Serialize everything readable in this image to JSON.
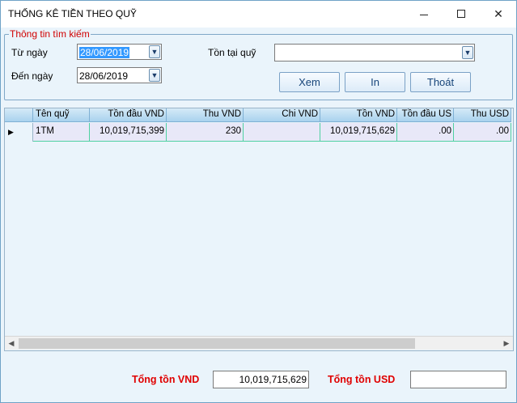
{
  "window": {
    "title": "THỐNG KÊ TIỀN THEO QUỸ"
  },
  "search": {
    "legend": "Thông tin tìm kiếm",
    "from_label": "Từ ngày",
    "from_value": "28/06/2019",
    "to_label": "Đến ngày",
    "to_value": "28/06/2019",
    "fund_label": "Tồn tại quỹ",
    "fund_value": ""
  },
  "buttons": {
    "view": "Xem",
    "print": "In",
    "exit": "Thoát"
  },
  "grid": {
    "columns": [
      "Tên quỹ",
      "Tồn đầu  VND",
      "Thu VND",
      "Chi VND",
      "Tồn VND",
      "Tồn đầu US",
      "Thu USD"
    ],
    "rows": [
      [
        "1TM",
        "10,019,715,399",
        "230",
        "",
        "10,019,715,629",
        ".00",
        ".00"
      ]
    ]
  },
  "totals": {
    "vnd_label": "Tổng tồn VND",
    "vnd_value": "10,019,715,629",
    "usd_label": "Tổng tồn USD",
    "usd_value": ""
  },
  "colors": {
    "accent_red": "#d00000",
    "header_blue": "#a9d2ee",
    "row_bg": "#e8e8f8",
    "grid_line": "#4fd1a2"
  }
}
